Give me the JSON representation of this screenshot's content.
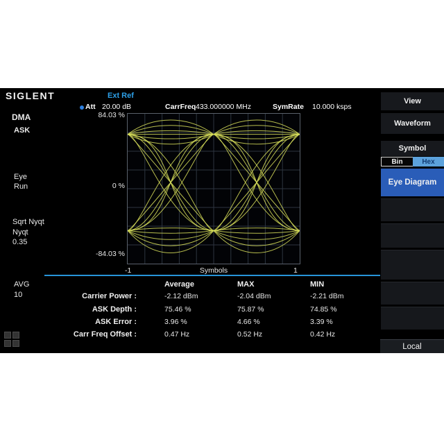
{
  "header": {
    "brand": "SIGLENT",
    "ref_status": "Ext Ref",
    "att_label": "Att",
    "att_value": "20.00 dB",
    "carrfreq_label": "CarrFreq",
    "carrfreq_value": "433.000000 MHz",
    "symrate_label": "SymRate",
    "symrate_value": "10.000 ksps"
  },
  "sidebar": {
    "mode": "DMA",
    "modulation": "ASK",
    "view_label": "Eye",
    "run_state": "Run",
    "filter_line1": "Sqrt Nyqt",
    "filter_line2": "Nyqt",
    "filter_value": "0.35",
    "avg_label": "AVG",
    "avg_value": "10"
  },
  "menu": {
    "view": "View",
    "waveform": "Waveform",
    "symbol": "Symbol",
    "symbol_format_bin": "Bin",
    "symbol_format_hex": "Hex",
    "symbol_format_selected": "Hex",
    "active_item": "Eye Diagram",
    "local": "Local"
  },
  "chart_data": {
    "type": "eye-diagram",
    "xlabel": "Symbols",
    "x_tick_left": "-1",
    "x_tick_right": "1",
    "y_tick_top": "84.03 %",
    "y_tick_mid": "0 %",
    "y_tick_bottom": "-84.03 %",
    "y_range_pct": [
      -84.03,
      84.03
    ],
    "x_range_symbols": [
      -1,
      1
    ],
    "grid": {
      "cols": 10,
      "rows": 8,
      "on": true
    },
    "trace_color": "#d8df5b",
    "grid_color": "#2e3540",
    "high_level_pct": 61,
    "low_level_pct": -47,
    "rail_bulges_high": [
      16,
      10,
      4,
      0,
      -5,
      -11
    ],
    "rail_bulges_low": [
      3,
      -3,
      -10,
      -17,
      -25
    ],
    "transition_controls": [
      [
        0.36,
        0.36
      ],
      [
        0.55,
        0.55
      ],
      [
        0.15,
        0.5
      ],
      [
        0.5,
        0.15
      ],
      [
        0.05,
        0.05
      ]
    ]
  },
  "table": {
    "headers": [
      "Average",
      "MAX",
      "MIN"
    ],
    "rows": [
      {
        "label": "Carrier Power :",
        "values": [
          "-2.12 dBm",
          "-2.04 dBm",
          "-2.21 dBm"
        ]
      },
      {
        "label": "ASK Depth :",
        "values": [
          "75.46 %",
          "75.87 %",
          "74.85 %"
        ]
      },
      {
        "label": "ASK Error :",
        "values": [
          "3.96 %",
          "4.66 %",
          "3.39 %"
        ]
      },
      {
        "label": "Carr Freq Offset :",
        "values": [
          "0.47 Hz",
          "0.52 Hz",
          "0.42 Hz"
        ]
      }
    ]
  },
  "colors": {
    "accent_blue": "#2da0e8",
    "menu_active": "#2a5db8",
    "hex_selected_bg": "#5ca2dc",
    "separator": "#2794d8",
    "trace": "#d8df5b"
  }
}
